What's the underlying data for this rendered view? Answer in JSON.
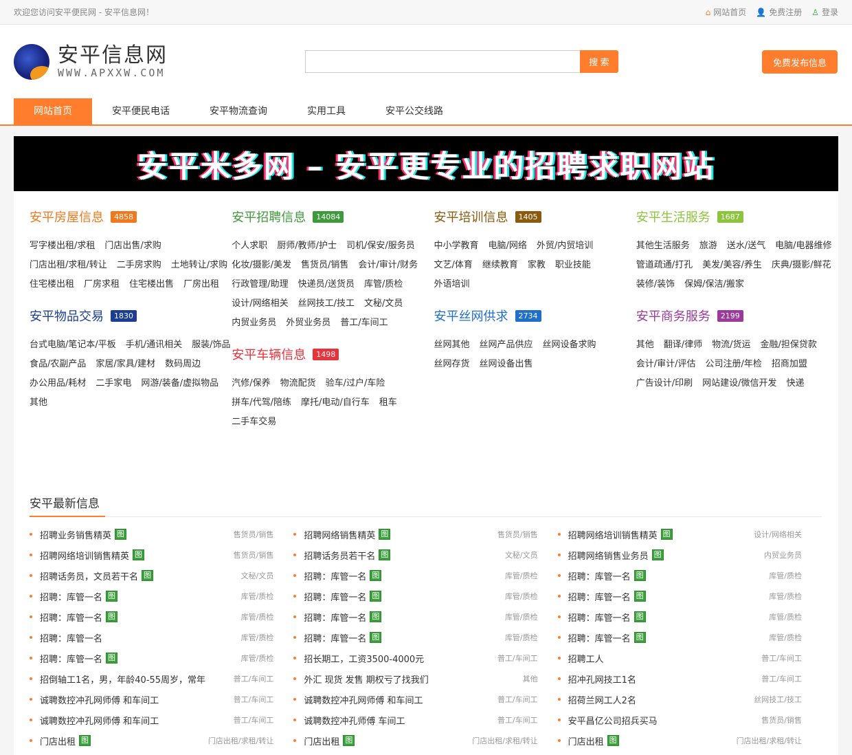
{
  "topbar": {
    "welcome": "欢迎您访问安平便民网 - 安平信息网！",
    "links": [
      {
        "icon": "home-icon",
        "label": "网站首页"
      },
      {
        "icon": "user-add-icon",
        "label": "免费注册"
      },
      {
        "icon": "user-icon",
        "label": "登录"
      }
    ]
  },
  "header": {
    "logo_cn": "安平信息网",
    "logo_en": "WWW.APXXW.COM",
    "search_placeholder": "",
    "search_button": "搜 索",
    "publish_button": "免费发布信息"
  },
  "nav": [
    "网站首页",
    "安平便民电话",
    "安平物流查询",
    "实用工具",
    "安平公交线路"
  ],
  "banner": "安平米多网 – 安平更专业的招聘求职网站",
  "colors": {
    "accent": "#ff7d2c"
  },
  "categories": [
    [
      {
        "title": "安平房屋信息",
        "count": "4858",
        "color": "#f0791e",
        "links": [
          "写字楼出租/求租",
          "门店出售/求购",
          "门店出租/求租/转让",
          "二手房求购",
          "土地转让/求购",
          "住宅楼出租",
          "厂房求租",
          "住宅楼出售",
          "厂房出租"
        ]
      },
      {
        "title": "安平物品交易",
        "count": "1830",
        "color": "#1b3e94",
        "links": [
          "台式电脑/笔记本/平板",
          "手机/通讯相关",
          "服装/饰品",
          "食品/农副产品",
          "家居/家具/建材",
          "数码周边",
          "办公用品/耗材",
          "二手家电",
          "网游/装备/虚拟物品",
          "其他"
        ]
      }
    ],
    [
      {
        "title": "安平招聘信息",
        "count": "14084",
        "color": "#3f9a3b",
        "links": [
          "个人求职",
          "厨师/教师/护士",
          "司机/保安/服务员",
          "化妆/摄影/美发",
          "售货员/销售",
          "会计/审计/财务",
          "行政管理/助理",
          "快递员/送货员",
          "库管/质检",
          "设计/网络相关",
          "丝网技工/技工",
          "文秘/文员",
          "内贸业务员",
          "外贸业务员",
          "普工/车间工"
        ]
      },
      {
        "title": "安平车辆信息",
        "count": "1498",
        "color": "#e8323c",
        "links": [
          "汽修/保养",
          "物流配货",
          "验车/过户/车险",
          "拼车/代驾/陪练",
          "摩托/电动/自行车",
          "租车",
          "二手车交易"
        ]
      }
    ],
    [
      {
        "title": "安平培训信息",
        "count": "1405",
        "color": "#8c5a0e",
        "links": [
          "中小学教育",
          "电脑/网络",
          "外贸/内贸培训",
          "文艺/体育",
          "继续教育",
          "家教",
          "职业技能",
          "外语培训"
        ]
      },
      {
        "title": "安平丝网供求",
        "count": "2734",
        "color": "#1f6fc8",
        "links": [
          "丝网其他",
          "丝网产品供应",
          "丝网设备求购",
          "丝网存货",
          "丝网设备出售"
        ]
      }
    ],
    [
      {
        "title": "安平生活服务",
        "count": "1687",
        "color": "#8cc43c",
        "links": [
          "其他生活服务",
          "旅游",
          "送水/送气",
          "电脑/电器维修",
          "管道疏通/打孔",
          "美发/美容/养生",
          "庆典/摄影/鲜花",
          "装修/装饰",
          "保姆/保洁/搬家"
        ]
      },
      {
        "title": "安平商务服务",
        "count": "2199",
        "color": "#9b3a9b",
        "links": [
          "其他",
          "翻译/律师",
          "物流/货运",
          "金融/担保贷款",
          "会计/审计/评估",
          "公司注册/年检",
          "招商加盟",
          "广告设计/印刷",
          "网站建设/微信开发",
          "快递"
        ]
      }
    ]
  ],
  "latest": {
    "title": "安平最新信息",
    "img_label": "图",
    "columns": [
      [
        [
          "招聘业务销售精英",
          1,
          "售货员/销售"
        ],
        [
          "招聘网络培训销售精英",
          1,
          "售货员/销售"
        ],
        [
          "招聘话务员，文员若干名",
          1,
          "文秘/文员"
        ],
        [
          "招聘：库管一名",
          1,
          "库管/质检"
        ],
        [
          "招聘：库管一名",
          1,
          "库管/质检"
        ],
        [
          "招聘：库管一名",
          0,
          "库管/质检"
        ],
        [
          "招聘：库管一名",
          1,
          "库管/质检"
        ],
        [
          "招倒轴工1名，男，年龄40-55周岁，常年",
          0,
          "普工/车间工"
        ],
        [
          "诚聘数控冲孔网师傅 和车间工",
          0,
          "普工/车间工"
        ],
        [
          "诚聘数控冲孔网师傅 和车间工",
          0,
          "普工/车间工"
        ],
        [
          "门店出租",
          1,
          "门店出租/求租/转让"
        ]
      ],
      [
        [
          "招聘网络销售精英",
          1,
          "售货员/销售"
        ],
        [
          "招聘话务员若干名",
          1,
          "文秘/文员"
        ],
        [
          "招聘：库管一名",
          1,
          "库管/质检"
        ],
        [
          "招聘：库管一名",
          1,
          "库管/质检"
        ],
        [
          "招聘：库管一名",
          1,
          "库管/质检"
        ],
        [
          "招聘：库管一名",
          1,
          "库管/质检"
        ],
        [
          "招长期工，工资3500-4000元",
          0,
          "普工/车间工"
        ],
        [
          "外汇 现货 发售 期权亏了找我们",
          0,
          "其他"
        ],
        [
          "诚聘数控冲孔网师傅 和车间工",
          0,
          "普工/车间工"
        ],
        [
          "诚聘数控冲孔师傅 车间工",
          0,
          "普工/车间工"
        ],
        [
          "门店出租",
          1,
          "门店出租/求租/转让"
        ]
      ],
      [
        [
          "招聘网络培训销售精英",
          1,
          "设计/网络相关"
        ],
        [
          "招聘网络销售业务员",
          1,
          "内贸业务员"
        ],
        [
          "招聘：库管一名",
          1,
          "库管/质检"
        ],
        [
          "招聘：库管一名",
          1,
          "库管/质检"
        ],
        [
          "招聘：库管一名",
          1,
          "库管/质检"
        ],
        [
          "招聘：库管一名",
          1,
          "库管/质检"
        ],
        [
          "招聘工人",
          0,
          "普工/车间工"
        ],
        [
          "招冲孔网技工1名",
          0,
          "普工/车间工"
        ],
        [
          "招荷兰网工人2名",
          0,
          "丝网技工/技工"
        ],
        [
          "安平昌亿公司招兵买马",
          0,
          "售货员/销售"
        ],
        [
          "门店出租",
          1,
          "门店出租/求租/转让"
        ]
      ]
    ]
  }
}
